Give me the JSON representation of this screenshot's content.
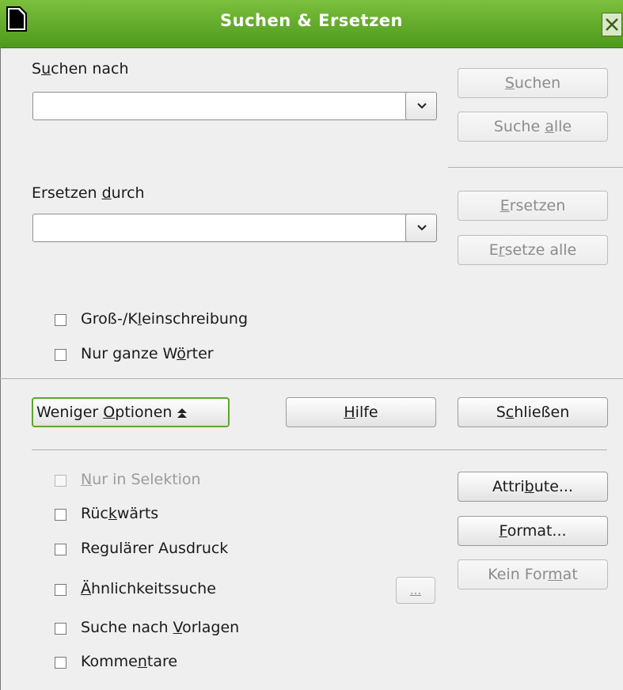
{
  "window": {
    "title": "Suchen & Ersetzen"
  },
  "search": {
    "label_pre": "S",
    "label_ul": "u",
    "label_post": "chen nach",
    "value": ""
  },
  "replace": {
    "label_pre": "Ersetzen ",
    "label_ul": "d",
    "label_post": "urch",
    "value": ""
  },
  "buttons": {
    "suchen": {
      "pre": "",
      "ul": "S",
      "post": "uchen"
    },
    "suche_alle": {
      "pre": "Suche ",
      "ul": "a",
      "post": "lle"
    },
    "ersetzen": {
      "pre": "",
      "ul": "E",
      "post": "rsetzen"
    },
    "ersetze_alle": {
      "pre": "E",
      "ul": "r",
      "post": "setze alle"
    },
    "weniger": {
      "pre": "Weniger ",
      "ul": "O",
      "post": "ptionen"
    },
    "hilfe": {
      "pre": "",
      "ul": "H",
      "post": "ilfe"
    },
    "schliessen": {
      "pre": "S",
      "ul": "c",
      "post": "hließen"
    },
    "attribute": {
      "pre": "Attri",
      "ul": "b",
      "post": "ute..."
    },
    "format": {
      "pre": "",
      "ul": "F",
      "post": "ormat..."
    },
    "kein_format": {
      "pre": "Kein For",
      "ul": "m",
      "post": "at"
    },
    "similarity_dots": {
      "pre": "",
      "ul": "...",
      "post": ""
    }
  },
  "options": {
    "gross_klein": {
      "pre": "Groß-/K",
      "ul": "l",
      "post": "einschreibung",
      "checked": false
    },
    "ganze_woerter": {
      "pre": "Nur ganze W",
      "ul": "ö",
      "post": "rter",
      "checked": false
    },
    "nur_selektion": {
      "pre": "",
      "ul": "N",
      "post": "ur in Selektion",
      "checked": false,
      "disabled": true
    },
    "rueckwaerts": {
      "pre": "Rüc",
      "ul": "k",
      "post": "wärts",
      "checked": false
    },
    "regulaer": {
      "pre": "Re",
      "ul": "g",
      "post": "ulärer Ausdruck",
      "checked": false
    },
    "aehnlich": {
      "pre": "",
      "ul": "Ä",
      "post": "hnlichkeitssuche",
      "checked": false
    },
    "vorlagen": {
      "pre": "Suche nach ",
      "ul": "V",
      "post": "orlagen",
      "checked": false
    },
    "kommentare": {
      "pre": "Komme",
      "ul": "n",
      "post": "tare",
      "checked": false
    }
  },
  "colors": {
    "titlebar": "#5fa825",
    "focus": "#5ea52e"
  }
}
